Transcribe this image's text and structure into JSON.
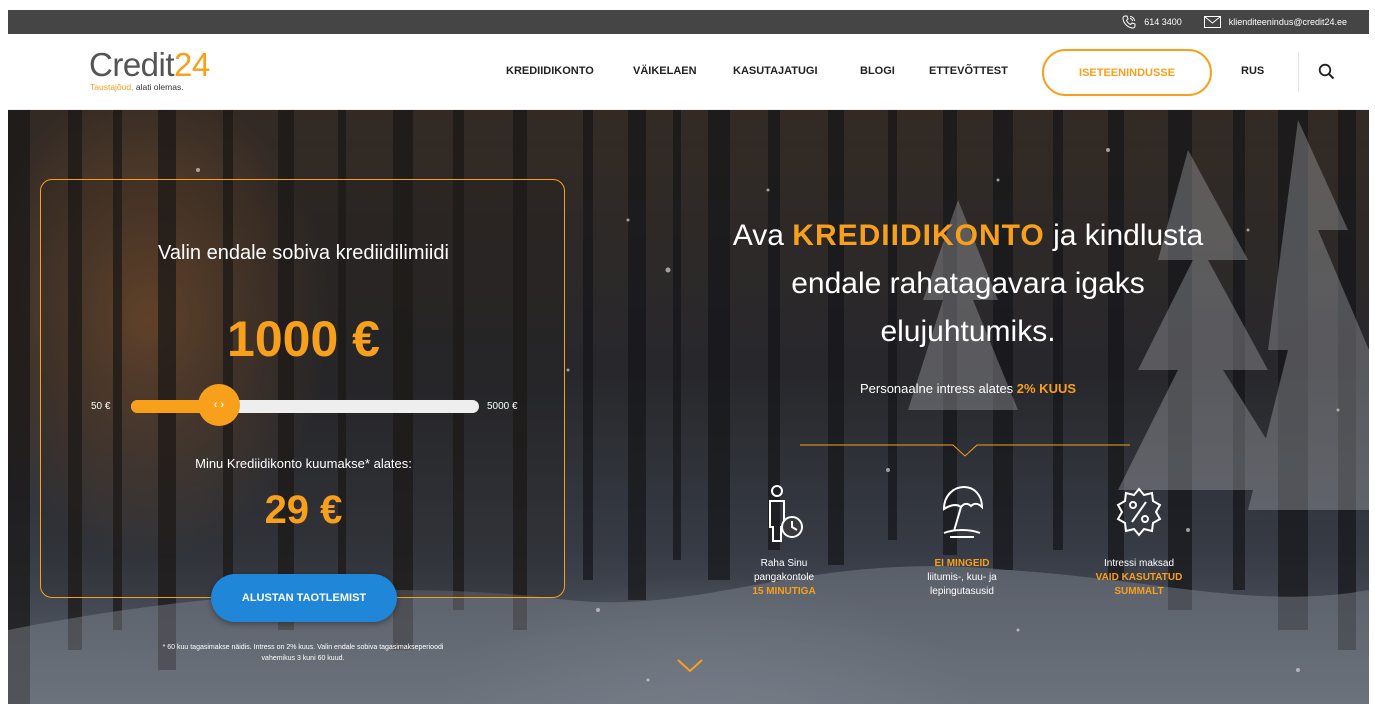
{
  "topbar": {
    "phone": "614 3400",
    "email": "klienditeenindus@credit24.ee",
    "phone_icon": "phone-icon",
    "email_icon": "envelope-icon"
  },
  "header": {
    "logo_main": "Credit",
    "logo_num": "24",
    "logo_tagline_orange": "Taustajõud,",
    "logo_tagline_rest": " alati olemas.",
    "nav": [
      "KREDIIDIKONTO",
      "VÄIKELAEN",
      "KASUTAJATUGI",
      "BLOGI",
      "ETTEVÕTTEST"
    ],
    "self_service": "ISETEENINDUSSE",
    "language": "RUS",
    "search_icon": "search-icon"
  },
  "calculator": {
    "title": "Valin endale sobiva krediidilimiidi",
    "amount": "1000 €",
    "min_label": "50 €",
    "max_label": "5000 €",
    "slider_min": 50,
    "slider_max": 5000,
    "slider_value": 1000,
    "thumb_glyph": "‹ ›",
    "monthly_label": "Minu Krediidikonto kuumakse* alates:",
    "monthly_value": "29 €",
    "apply_button": "ALUSTAN TAOTLEMIST",
    "footnote_1": "* 60 kuu tagasimakse näidis. Intress on 2% kuus. Valin endale sobiva tagasimakseperioodi",
    "footnote_2": "vahemikus 3 kuni 60 kuud."
  },
  "hero": {
    "headline_pre": "Ava ",
    "headline_highlight": "KREDIIDIKONTO",
    "headline_post_1": " ja kindlusta",
    "headline_line_2": "endale rahatagavara igaks",
    "headline_line_3": "elujuhtumiks.",
    "interest_pre": "Personaalne intress alates ",
    "interest_highlight": "2% KUUS"
  },
  "features": [
    {
      "icon": "person-clock-icon",
      "line1": "Raha Sinu",
      "line2": "pangakontole",
      "highlight": "15 MINUTIGA"
    },
    {
      "icon": "beach-umbrella-icon",
      "highlight": "EI MINGEID",
      "line1": "liitumis-, kuu- ja",
      "line2": "lepingutasusid"
    },
    {
      "icon": "percent-badge-icon",
      "line1": "Intressi maksad",
      "highlight1": "VAID KASUTATUD",
      "highlight2": "SUMMALT"
    }
  ],
  "scroll_icon": "chevron-down-icon",
  "colors": {
    "accent": "#f8a01c",
    "button_blue": "#1f86d8",
    "topbar": "#454545"
  }
}
